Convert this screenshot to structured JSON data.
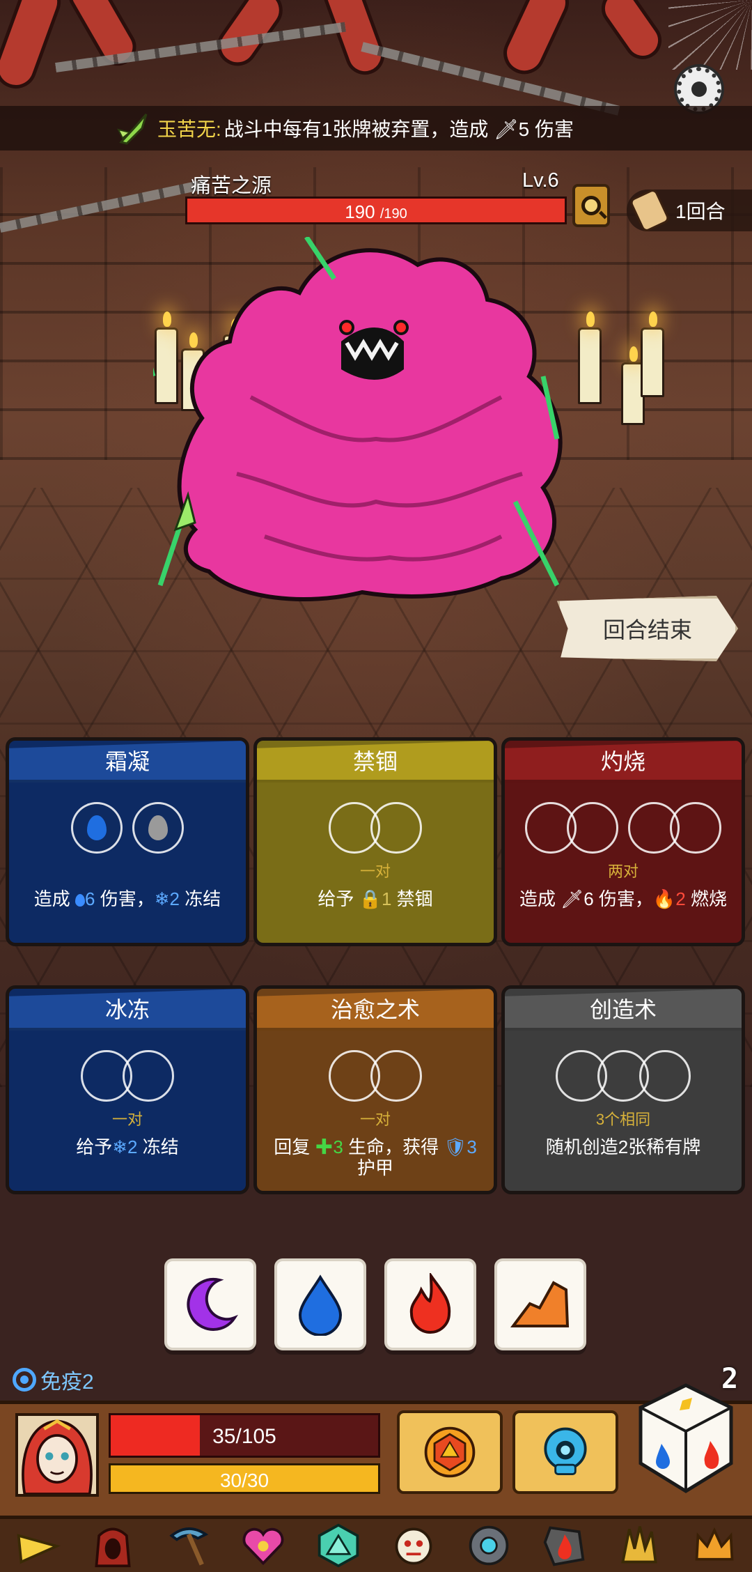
{
  "relic_banner": {
    "name": "玉苦无:",
    "desc": "战斗中每有1张牌被弃置，造成 🗡5 伤害"
  },
  "enemy": {
    "name": "痛苦之源",
    "level": "Lv.6",
    "hp_current": "190",
    "hp_max": "/190",
    "hp_fraction": 1.0
  },
  "turn": {
    "label": "1回合"
  },
  "end_turn_button": "回合结束",
  "skill_cards": [
    {
      "title": "霜凝",
      "color": "blue",
      "requirement": "",
      "desc_pre": "造成 ",
      "desc_num1": "6",
      "desc_mid": " 伤害，",
      "desc_num2": "❄2",
      "desc_post": " 冻结"
    },
    {
      "title": "禁锢",
      "color": "yellow",
      "requirement": "一对",
      "desc_pre": "给予 ",
      "desc_num1": "🔒1",
      "desc_mid": " 禁锢",
      "desc_num2": "",
      "desc_post": ""
    },
    {
      "title": "灼烧",
      "color": "red",
      "requirement": "两对",
      "desc_pre": "造成 ",
      "desc_num1": "🗡6",
      "desc_mid": " 伤害，",
      "desc_num2": "🔥2",
      "desc_post": " 燃烧"
    },
    {
      "title": "冰冻",
      "color": "blue",
      "requirement": "一对",
      "desc_pre": "给予",
      "desc_num1": "❄2",
      "desc_mid": " 冻结",
      "desc_num2": "",
      "desc_post": ""
    },
    {
      "title": "治愈之术",
      "color": "orange",
      "requirement": "一对",
      "desc_pre": "回复 ",
      "desc_num1": "✚3",
      "desc_mid": " 生命，获得 ",
      "desc_num2": "🛡3",
      "desc_post": " 护甲"
    },
    {
      "title": "创造术",
      "color": "gray",
      "requirement": "3个相同",
      "desc_pre": "随机创造2张稀有牌",
      "desc_num1": "",
      "desc_mid": "",
      "desc_num2": "",
      "desc_post": ""
    }
  ],
  "dice_tray": [
    "moon-purple",
    "water-drop-blue",
    "fire-red",
    "rock-orange"
  ],
  "status": {
    "immune": "免疫2",
    "dice_remaining": "2"
  },
  "player": {
    "hp_text": "35/105",
    "hp_fraction": 0.333,
    "energy_text": "30/30",
    "energy_fraction": 1.0
  },
  "relics": [
    "cheese-relic",
    "hood-relic",
    "pickaxe-relic",
    "heart-amulet-relic",
    "d20-relic",
    "tribal-mask-relic",
    "eye-stone-relic",
    "fire-stone-relic",
    "claw-relic",
    "crown-relic"
  ],
  "colors": {
    "hp_red": "#e6362a",
    "energy_yellow": "#f5b720",
    "relic_name_yellow": "#f2d44a"
  }
}
